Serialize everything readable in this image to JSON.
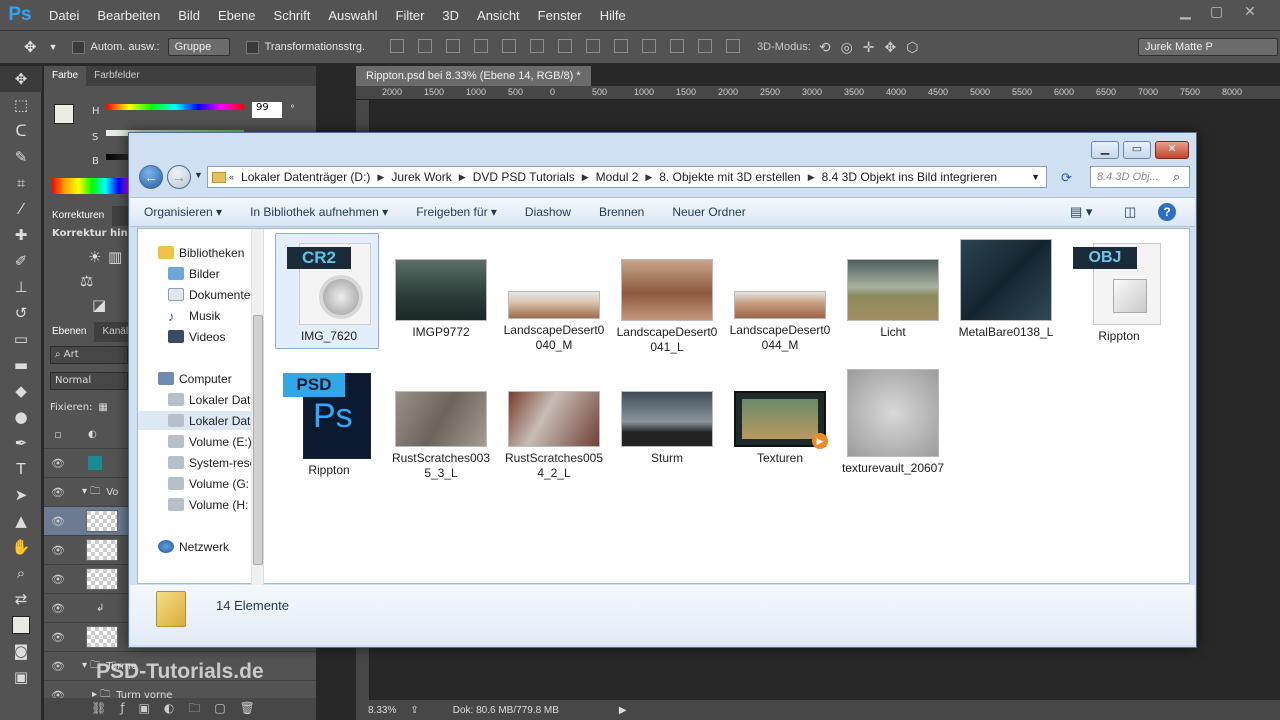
{
  "app": {
    "logo": "Ps"
  },
  "menubar": [
    "Datei",
    "Bearbeiten",
    "Bild",
    "Ebene",
    "Schrift",
    "Auswahl",
    "Filter",
    "3D",
    "Ansicht",
    "Fenster",
    "Hilfe"
  ],
  "options": {
    "auto_select_label": "Autom. ausw.:",
    "auto_select_value": "Gruppe",
    "transform_label": "Transformationsstrg.",
    "mode_label": "3D-Modus:",
    "workspace": "Jurek Matte P"
  },
  "color_panel": {
    "tabs": [
      "Farbe",
      "Farbfelder"
    ],
    "h_label": "H",
    "s_label": "S",
    "b_label": "B",
    "h_value": "99",
    "unit": "°"
  },
  "adjustments_panel": {
    "tab": "Korrekturen",
    "hint": "Korrektur hinzu"
  },
  "layers_panel": {
    "tabs": [
      "Ebenen",
      "Kanäle"
    ],
    "filter": "Art",
    "blend_mode": "Normal",
    "lock_label": "Fixieren:",
    "group_vol": "Vo",
    "group_tuerme": "Türme",
    "group_turm": "Turm vorne"
  },
  "document": {
    "tab_title": "Rippton.psd bei 8.33% (Ebene 14, RGB/8) *",
    "ruler_ticks": [
      "2000",
      "1500",
      "1000",
      "500",
      "0",
      "500",
      "1000",
      "1500",
      "2000",
      "2500",
      "3000",
      "3500",
      "4000",
      "4500",
      "5000",
      "5500",
      "6000",
      "6500",
      "7000",
      "7500",
      "8000"
    ],
    "zoom": "8.33%",
    "doc_size": "Dok: 80.6 MB/779.8 MB"
  },
  "explorer": {
    "breadcrumb": [
      "Lokaler Datenträger (D:)",
      "Jurek Work",
      "DVD PSD Tutorials",
      "Modul 2",
      "8. Objekte mit 3D erstellen",
      "8.4 3D Objekt ins Bild integrieren"
    ],
    "search_placeholder": "8.4 3D Obj...",
    "toolbar": [
      "Organisieren ▾",
      "In Bibliothek aufnehmen ▾",
      "Freigeben für ▾",
      "Diashow",
      "Brennen",
      "Neuer Ordner"
    ],
    "nav": {
      "libraries": "Bibliotheken",
      "pictures": "Bilder",
      "documents": "Dokumente",
      "music": "Musik",
      "videos": "Videos",
      "computer": "Computer",
      "drive1": "Lokaler Dat",
      "drive2": "Lokaler Dat",
      "drive3": "Volume (E:)",
      "drive4": "System-rese",
      "drive5": "Volume (G:",
      "drive6": "Volume (H:",
      "network": "Netzwerk"
    },
    "files": [
      {
        "name": "IMG_7620",
        "kind": "cr2",
        "badge": "CR2"
      },
      {
        "name": "IMGP9772",
        "kind": "photo"
      },
      {
        "name": "LandscapeDesert0040_M",
        "kind": "photo"
      },
      {
        "name": "LandscapeDesert0041_L",
        "kind": "photo"
      },
      {
        "name": "LandscapeDesert0044_M",
        "kind": "photo"
      },
      {
        "name": "Licht",
        "kind": "photo"
      },
      {
        "name": "MetalBare0138_L",
        "kind": "photo"
      },
      {
        "name": "Rippton",
        "kind": "obj",
        "badge": "OBJ"
      },
      {
        "name": "Rippton",
        "kind": "psd",
        "badge": "PSD",
        "badge2": "Ps"
      },
      {
        "name": "RustScratches0035_3_L",
        "kind": "photo"
      },
      {
        "name": "RustScratches0054_2_L",
        "kind": "photo"
      },
      {
        "name": "Sturm",
        "kind": "photo"
      },
      {
        "name": "Texturen",
        "kind": "video"
      },
      {
        "name": "texturevault_20607",
        "kind": "photo"
      }
    ],
    "status": "14 Elemente"
  },
  "watermark": "PSD-Tutorials.de"
}
